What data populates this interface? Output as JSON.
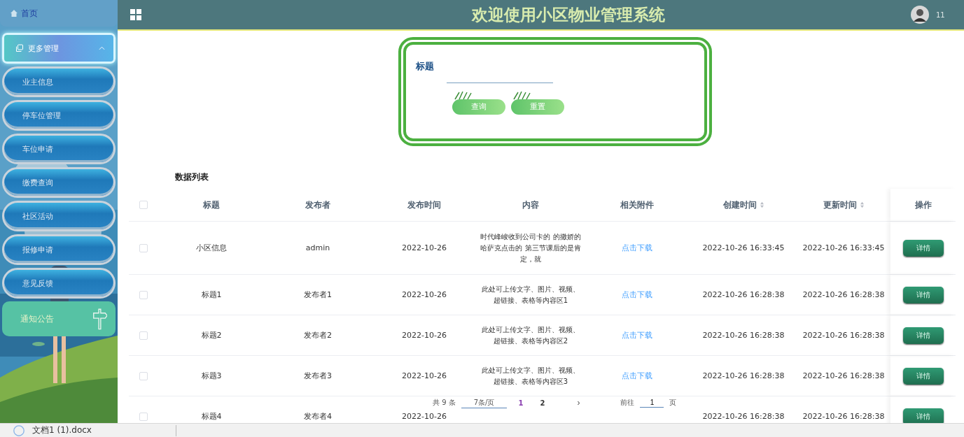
{
  "sidebar": {
    "home": {
      "label": "首页"
    },
    "group": {
      "label": "更多管理",
      "expanded": true
    },
    "items": [
      {
        "label": "业主信息",
        "selected": false
      },
      {
        "label": "停车位管理",
        "selected": false
      },
      {
        "label": "车位申请",
        "selected": false
      },
      {
        "label": "缴费查询",
        "selected": false
      },
      {
        "label": "社区活动",
        "selected": false
      },
      {
        "label": "报修申请",
        "selected": false
      },
      {
        "label": "意见反馈",
        "selected": false
      },
      {
        "label": "通知公告",
        "selected": true
      }
    ]
  },
  "header": {
    "title": "欢迎使用小区物业管理系统",
    "user": "11"
  },
  "search": {
    "label": "标题",
    "buttons": [
      "查询",
      "重置"
    ]
  },
  "list_title": "数据列表",
  "table": {
    "select_all": false,
    "columns": [
      {
        "label": "标题"
      },
      {
        "label": "发布者"
      },
      {
        "label": "发布时间"
      },
      {
        "label": "内容"
      },
      {
        "label": "相关附件"
      },
      {
        "label": "创建时间",
        "sortable": true
      },
      {
        "label": "更新时间",
        "sortable": true
      },
      {
        "label": "操作"
      }
    ],
    "rows": [
      {
        "checked": false,
        "title": "小区信息",
        "publisher": "admin",
        "date": "2022-10-26",
        "content": "时代峰峻收到公司卡的 的撒娇的哈萨克点击的 第三节课后的是肯定，就",
        "attachment": "点击下载",
        "created": "2022-10-26 16:33:45",
        "updated": "2022-10-26 16:33:45",
        "action": "详情"
      },
      {
        "checked": false,
        "title": "标题1",
        "publisher": "发布者1",
        "date": "2022-10-26",
        "content": "此处可上传文字、图片、视频、超链接、表格等内容区1",
        "attachment": "点击下载",
        "created": "2022-10-26 16:28:38",
        "updated": "2022-10-26 16:28:38",
        "action": "详情"
      },
      {
        "checked": false,
        "title": "标题2",
        "publisher": "发布者2",
        "date": "2022-10-26",
        "content": "此处可上传文字、图片、视频、超链接、表格等内容区2",
        "attachment": "点击下载",
        "created": "2022-10-26 16:28:38",
        "updated": "2022-10-26 16:28:38",
        "action": "详情"
      },
      {
        "checked": false,
        "title": "标题3",
        "publisher": "发布者3",
        "date": "2022-10-26",
        "content": "此处可上传文字、图片、视频、超链接、表格等内容区3",
        "attachment": "点击下载",
        "created": "2022-10-26 16:28:38",
        "updated": "2022-10-26 16:28:38",
        "action": "详情"
      },
      {
        "checked": false,
        "title": "标题4",
        "publisher": "发布者4",
        "date": "2022-10-26",
        "created": "2022-10-26 16:28:38",
        "updated": "2022-10-26 16:28:38",
        "action": "详情"
      }
    ]
  },
  "pagination": {
    "total": "共 9 条",
    "page_size": "7条/页",
    "pages": [
      {
        "label": "1",
        "selected": true
      },
      {
        "label": "2",
        "selected": false
      }
    ],
    "next": "›",
    "goto_label": "前往",
    "goto_value": "1",
    "goto_unit": "页"
  },
  "download_bar": {
    "file": "文档1 (1).docx"
  }
}
